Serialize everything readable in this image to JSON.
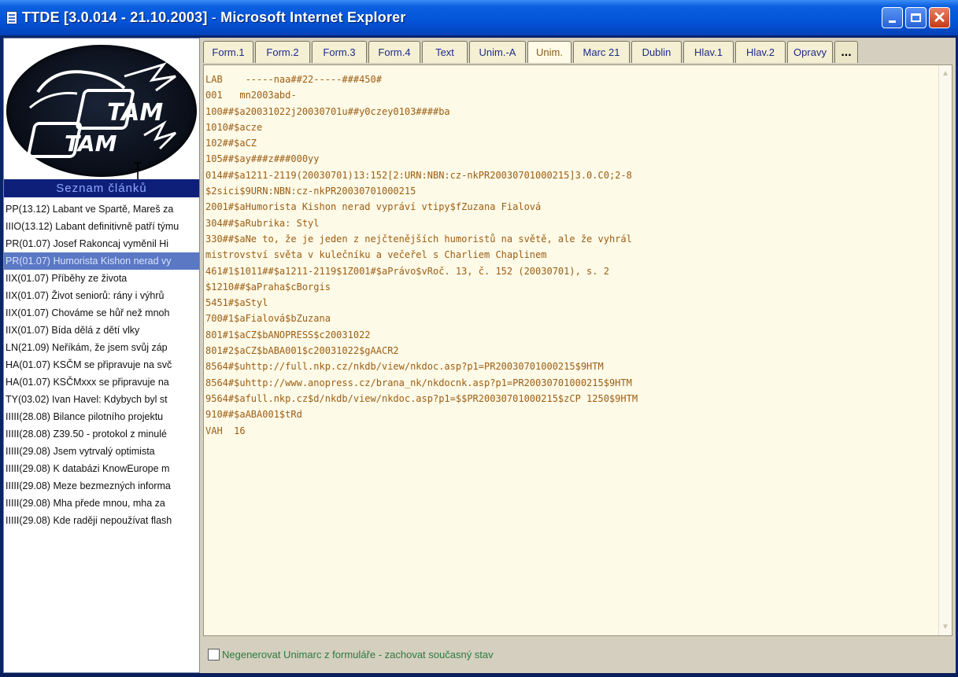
{
  "window": {
    "title_app": "TTDE [3.0.014 - 21.10.2003]",
    "title_sep": " - ",
    "title_browser": "Microsoft Internet Explorer"
  },
  "left": {
    "list_header": "Seznam článků",
    "articles": [
      "PP(13.12) Labant ve Spartě, Mareš za",
      "IIIO(13.12) Labant definitivně patří týmu",
      "PR(01.07) Josef Rakoncaj vyměnil Hi",
      "PR(01.07) Humorista Kishon nerad vy",
      "IIX(01.07) Příběhy ze života",
      "IIX(01.07) Život seniorů: rány i výhrů",
      "IIX(01.07) Chováme se hůř než mnoh",
      "IIX(01.07) Bída dělá z dětí vlky",
      "LN(21.09) Neříkám, že jsem svůj záp",
      "HA(01.07) KSČM se připravuje na svč",
      "HA(01.07) KSČMxxx se připravuje na",
      "TY(03.02) Ivan Havel: Kdybych byl st",
      "IIIII(28.08) Bilance pilotního projektu",
      "IIIII(28.08) Z39.50 - protokol z minulé",
      "IIIII(29.08) Jsem vytrvalý optimista",
      "IIIII(29.08) K databázi KnowEurope m",
      "IIIII(29.08) Meze bezmezných informa",
      "IIIII(29.08) Mha přede mnou, mha za",
      "IIIII(29.08) Kde raději nepoužívat flash"
    ]
  },
  "tabs": [
    "Form.1",
    "Form.2",
    "Form.3",
    "Form.4",
    "Text",
    "Unim.-A",
    "Unim.",
    "Marc 21",
    "Dublin",
    "Hlav.1",
    "Hlav.2",
    "Opravy",
    "..."
  ],
  "active_tab": "Unim.",
  "marc_lines": [
    "LAB    -----naa##22-----###450#",
    "001   mn2003abd-",
    "100##$a20031022j20030701u##y0czey0103####ba",
    "1010#$acze",
    "102##$aCZ",
    "105##$ay###z###000yy",
    "014##$a1211-2119(20030701)13:152[2:URN:NBN:cz-nkPR20030701000215]3.0.C0;2-8",
    "$2sici$9URN:NBN:cz-nkPR20030701000215",
    "2001#$aHumorista Kishon nerad vypráví vtipy$fZuzana Fialová",
    "304##$aRubrika: Styl",
    "330##$aNe to, že je jeden z nejčtenějších humoristů na světě, ale že vyhrál",
    "mistrovství světa v kulečníku a večeřel s Charliem Chaplinem",
    "461#1$1011##$a1211-2119$1Z001#$aPrávo$vRoč. 13, č. 152 (20030701), s. 2",
    "$1210##$aPraha$cBorgis",
    "5451#$aStyl",
    "700#1$aFialová$bZuzana",
    "801#1$aCZ$bANOPRESS$c20031022",
    "801#2$aCZ$bABA001$c20031022$gAACR2",
    "8564#$uhttp://full.nkp.cz/nkdb/view/nkdoc.asp?p1=PR20030701000215$9HTM",
    "8564#$uhttp://www.anopress.cz/brana_nk/nkdocnk.asp?p1=PR20030701000215$9HTM",
    "9564#$afull.nkp.cz$d/nkdb/view/nkdoc.asp?p1=$$PR20030701000215$zCP 1250$9HTM",
    "910##$aABA001$tRd",
    "VAH  16"
  ],
  "footer": {
    "checkbox_label": "Negenerovat Unimarc z formuláře - zachovat současný stav",
    "checked": false
  },
  "colors": {
    "titlebar": "#0454d8",
    "marc_text": "#9c5d14",
    "tab_text": "#1d2a8a",
    "selected_row": "#5a78c4",
    "list_header": "#0e1f7a"
  }
}
